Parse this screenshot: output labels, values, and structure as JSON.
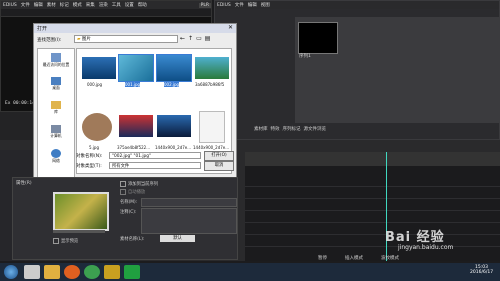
{
  "player": {
    "menu": [
      "EDIUS",
      "文件",
      "编辑",
      "素材",
      "标记",
      "模式",
      "采集",
      "渲染",
      "工具",
      "设置",
      "帮助"
    ],
    "mode_badge": "PLR",
    "timecode": "Ex 00:00:14:"
  },
  "bin": {
    "menu": [
      "EDIUS",
      "文件",
      "编辑",
      "视图"
    ],
    "clip_label": "序列1",
    "tabs": [
      "素材库",
      "特效",
      "序列标记",
      "源文件浏览"
    ]
  },
  "edius_side": "EDIUS 无标题",
  "dialog": {
    "title": "打开",
    "lookin_label": "查找范围(I):",
    "lookin_value": "图片",
    "nav": [
      "最近访问的位置",
      "桌面",
      "库",
      "计算机",
      "网络"
    ],
    "files": [
      {
        "name": "000.jpg"
      },
      {
        "name": "001.jpg",
        "selected": true
      },
      {
        "name": "002.jpg",
        "selected": true
      },
      {
        "name": "3a6887b986f5"
      },
      {
        "name": "5.jpg"
      },
      {
        "name": "375ae4b8f522..."
      },
      {
        "name": "1440x900_2d7e..."
      },
      {
        "name": "1440x900_2d7e..."
      }
    ],
    "filename_label": "对象名称(N):",
    "filename_value": "\"002.jpg\" \"01.jpg\"",
    "filetype_label": "对象类型(T):",
    "filetype_value": "所有文件",
    "open_button": "打开(O)",
    "cancel_button": "取消",
    "preview_label": "属性(R)",
    "checkbox_sequence": "添加到当前序列",
    "checkbox_auto": "自动播放",
    "name_label": "名称(M):",
    "comment_label": "注释(C):",
    "reel_label": "素材名称(L):",
    "reel_button": "默认",
    "checkbox_bottom": "显示预览"
  },
  "timeline_status": [
    "暂停",
    "插入模式",
    "波纹模式"
  ],
  "taskbar": {
    "time": "15:03",
    "date": "2016/6/17",
    "icon_names": [
      "start-orb",
      "media-icon",
      "explorer-icon",
      "firefox-icon",
      "chrome-icon",
      "edius-icon",
      "app-icon"
    ]
  },
  "watermark": {
    "text": "Bai 经验",
    "sub": "jingyan.baidu.com"
  },
  "colors": {
    "accent_cursor": "#40d8c0",
    "selection": "#3a7bd5",
    "taskbar": "#1d2a3b"
  }
}
